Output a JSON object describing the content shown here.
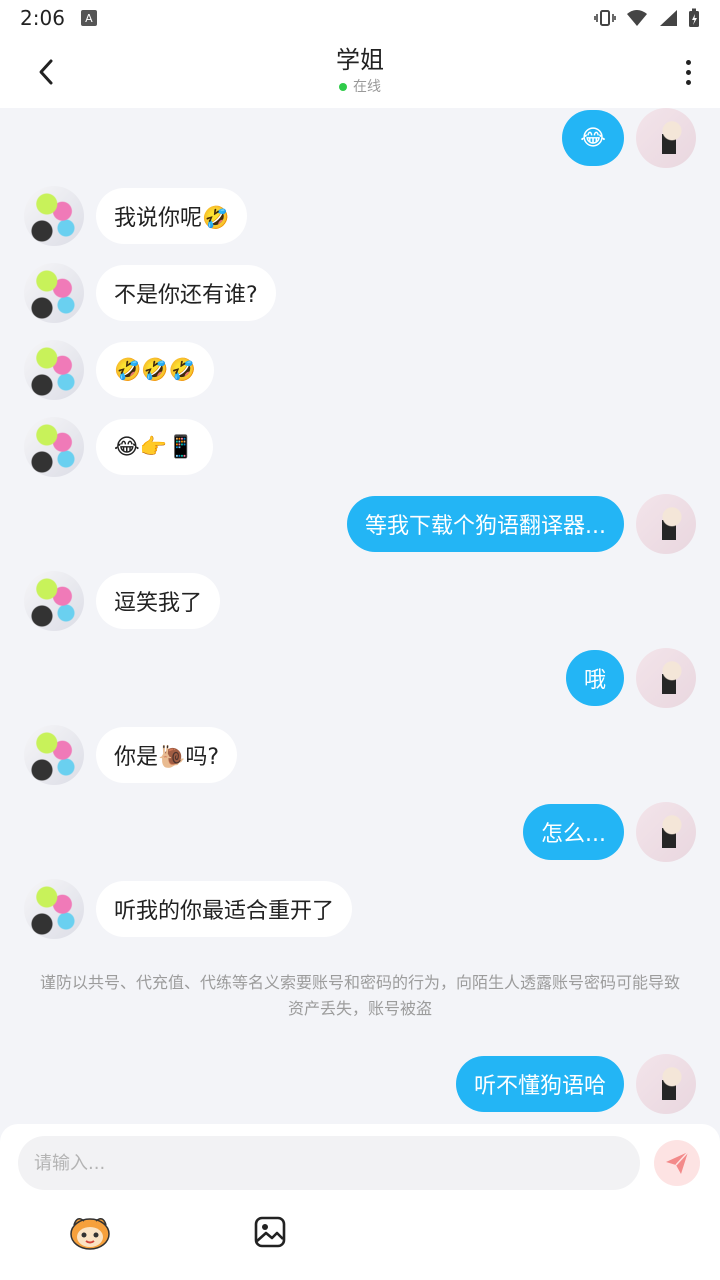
{
  "status_bar": {
    "time": "2:06",
    "notif_letter": "A"
  },
  "header": {
    "title": "学姐",
    "status": "在线"
  },
  "messages": [
    {
      "side": "right",
      "text": "😂",
      "top": 0
    },
    {
      "side": "left",
      "text": "我说你呢🤣"
    },
    {
      "side": "left",
      "text": "不是你还有谁?"
    },
    {
      "side": "left",
      "text": "🤣🤣🤣"
    },
    {
      "side": "left",
      "text": "😂👉📱"
    },
    {
      "side": "right",
      "text": "等我下载个狗语翻译器..."
    },
    {
      "side": "left",
      "text": "逗笑我了"
    },
    {
      "side": "right",
      "text": "哦"
    },
    {
      "side": "left",
      "text": "你是🐌吗?"
    },
    {
      "side": "right",
      "text": "怎么..."
    },
    {
      "side": "left",
      "text": "听我的你最适合重开了"
    },
    {
      "side": "right",
      "text": "听不懂狗语哈"
    }
  ],
  "notice": "谨防以共号、代充值、代练等名义索要账号和密码的行为，向陌生人透露账号密码可能导致资产丢失，账号被盗",
  "input": {
    "placeholder": "请输入..."
  },
  "colors": {
    "accent": "#23b5f5",
    "online": "#2fcb4a",
    "send_bg": "#fde3e3",
    "send_fg": "#f38a8a"
  },
  "icons": [
    "back-arrow-icon",
    "more-vertical-icon",
    "online-dot-icon",
    "send-icon",
    "mascot-icon",
    "image-icon"
  ]
}
